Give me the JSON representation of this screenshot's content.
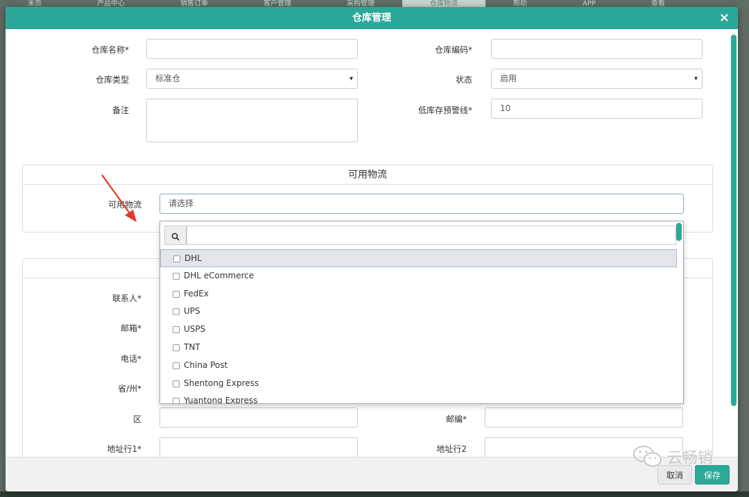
{
  "background_nav": {
    "items": [
      "未页",
      "产品中心",
      "销售订单",
      "客户管理",
      "采购管理",
      "仓库物流",
      "帮助",
      "APP",
      "查看"
    ],
    "active_index": 5
  },
  "modal": {
    "title": "仓库管理",
    "close_icon": "×"
  },
  "form": {
    "warehouse_name": {
      "label": "仓库名称*",
      "value": ""
    },
    "warehouse_code": {
      "label": "仓库编码*",
      "value": ""
    },
    "warehouse_type": {
      "label": "仓库类型",
      "value": "标准仓"
    },
    "status": {
      "label": "状态",
      "value": "启用"
    },
    "remark": {
      "label": "备注",
      "value": ""
    },
    "low_stock_alert": {
      "label": "低库存预警线*",
      "value": "10"
    }
  },
  "logistics_panel": {
    "title": "可用物流",
    "label": "可用物流",
    "placeholder": "请选择",
    "search_value": "",
    "options": [
      "DHL",
      "DHL eCommerce",
      "FedEx",
      "UPS",
      "USPS",
      "TNT",
      "China Post",
      "Shentong Express",
      "Yuantong Express"
    ],
    "highlighted_index": 0
  },
  "address_panel": {
    "contact": {
      "label": "联系人*"
    },
    "email": {
      "label": "邮箱*"
    },
    "phone": {
      "label": "电话*"
    },
    "province": {
      "label": "省/州*"
    },
    "district": {
      "label": "区",
      "value": ""
    },
    "postcode": {
      "label": "邮编*",
      "value": ""
    },
    "address1": {
      "label": "地址行1*",
      "value": ""
    },
    "address2": {
      "label": "地址行2",
      "value": ""
    }
  },
  "footer": {
    "cancel": "取消",
    "save": "保存"
  },
  "watermark": {
    "text": "云畅销"
  },
  "colors": {
    "accent": "#2ba898",
    "arrow": "#e0392b"
  }
}
